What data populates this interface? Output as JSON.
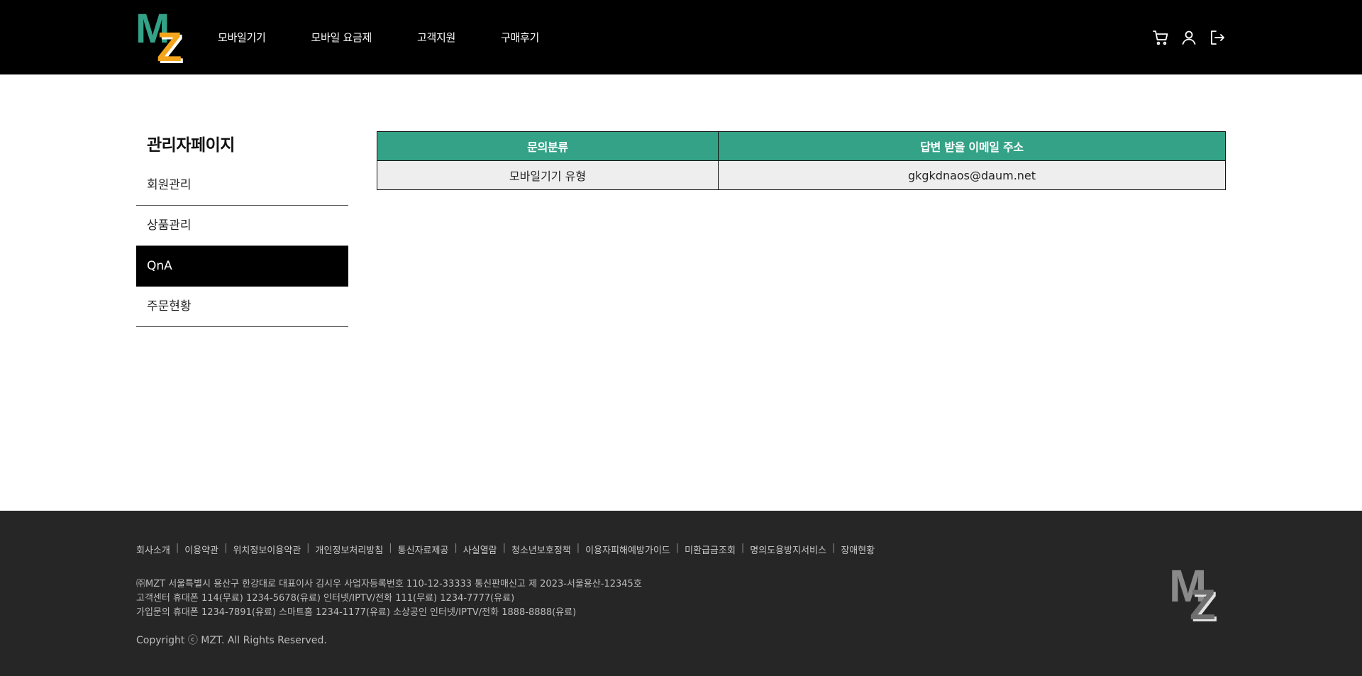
{
  "header": {
    "logo_letters": [
      "M",
      "Z"
    ],
    "logo_colors": {
      "m": "#33a287",
      "z": "#f5a51c"
    },
    "nav": [
      {
        "label": "모바일기기"
      },
      {
        "label": "모바일 요금제"
      },
      {
        "label": "고객지원"
      },
      {
        "label": "구매후기"
      }
    ],
    "icons": [
      "cart-icon",
      "user-icon",
      "logout-icon"
    ]
  },
  "sidebar": {
    "title": "관리자페이지",
    "items": [
      {
        "label": "회원관리",
        "active": false
      },
      {
        "label": "상품관리",
        "active": false
      },
      {
        "label": "QnA",
        "active": true
      },
      {
        "label": "주문현황",
        "active": false
      }
    ]
  },
  "table": {
    "headers": [
      "문의분류",
      "답변 받을 이메일 주소"
    ],
    "rows": [
      [
        "모바일기기 유형",
        "gkgkdnaos@daum.net"
      ]
    ]
  },
  "footer": {
    "links": [
      "회사소개",
      "이용약관",
      "위치정보이용약관",
      "개인정보처리방침",
      "통신자료제공",
      "사실열람",
      "청소년보호정책",
      "이용자피해예방가이드",
      "미환급금조회",
      "명의도용방지서비스",
      "장애현황"
    ],
    "info_lines": [
      "㈜MZT 서울특별시 용산구 한강대로 대표이사 김시우 사업자등록번호 110-12-33333 통신판매신고 제 2023-서울용산-12345호",
      "고객센터 휴대폰 114(무료) 1234-5678(유료) 인터넷/IPTV/전화 111(무료) 1234-7777(유료)",
      "가입문의 휴대폰 1234-7891(유료) 스마트홈 1234-1177(유료) 소상공인 인터넷/IPTV/전화 1888-8888(유료)"
    ],
    "copyright": "Copyright ⓒ MZT. All Rights Reserved.",
    "logo_letters": [
      "M",
      "Z"
    ]
  },
  "colors": {
    "accent": "#33a287",
    "header_bg": "#000000",
    "footer_bg": "#262626",
    "logo_orange": "#f5a51c"
  }
}
